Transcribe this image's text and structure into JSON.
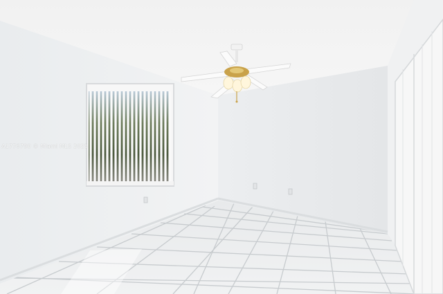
{
  "scene": {
    "subject": "empty room interior",
    "watermark_text": "A1776790 © Miami MLS 2025",
    "colors": {
      "wall_left": "#eef0f2",
      "wall_back": "#e7e9eb",
      "wall_right": "#f1f2f3",
      "ceiling": "#f3f3f3",
      "floor_tile": "#e9ebec",
      "grout": "#c9cdd0",
      "closet_door": "#f6f6f6",
      "fan_blade": "#fafafa",
      "fan_brass": "#c9a24a"
    },
    "icons": [
      "ceiling-fan-icon",
      "window-blinds-icon",
      "closet-door-icon",
      "outlet-icon"
    ]
  }
}
